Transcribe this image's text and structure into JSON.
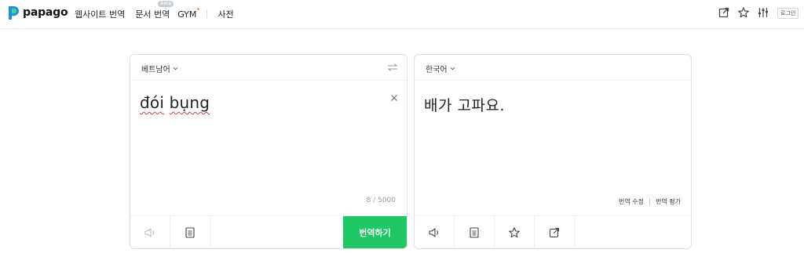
{
  "brand": {
    "name": "papago",
    "accent": "#1ec864",
    "logo_blue": "#1f8cf0",
    "logo_green": "#4cd964"
  },
  "nav": {
    "website_translate": "웹사이트 번역",
    "doc_translate": "문서 번역",
    "beta_badge": "Beta",
    "gym": "GYM",
    "dictionary": "사전"
  },
  "header_actions": {
    "icons": [
      "share-icon",
      "star-icon",
      "settings-sliders-icon"
    ],
    "login_label": "로그인"
  },
  "source": {
    "language": "베트남어",
    "text_word1": "đói",
    "text_word2": "bụng",
    "char_count": "8 / 5000",
    "translate_label": "번역하기",
    "icons": [
      "speaker-icon",
      "note-icon",
      "swap-icon",
      "clear-icon"
    ]
  },
  "target": {
    "language": "한국어",
    "text": "배가 고파요.",
    "edit_label": "번역 수정",
    "rate_label": "번역 평가",
    "icons": [
      "speaker-icon",
      "note-icon",
      "star-icon",
      "share-icon"
    ]
  }
}
